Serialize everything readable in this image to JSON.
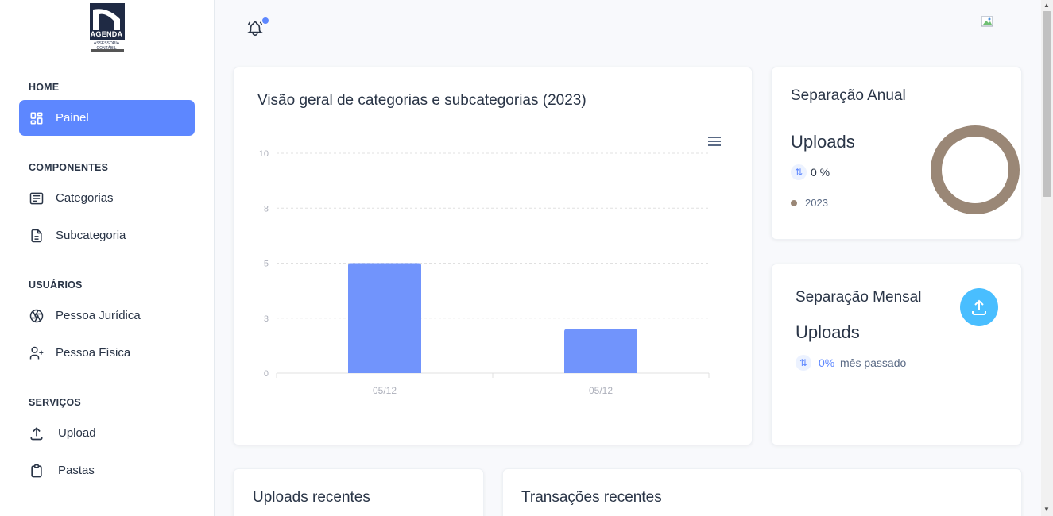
{
  "logo": {
    "brand": "AGENDA",
    "tagline": "ASSESSORIA CONTÁBIL"
  },
  "sidebar": {
    "sections": [
      {
        "caption": "HOME",
        "items": [
          {
            "label": "Painel",
            "icon": "layout-dashboard-icon",
            "active": true
          }
        ]
      },
      {
        "caption": "COMPONENTES",
        "items": [
          {
            "label": "Categorias",
            "icon": "article-icon"
          },
          {
            "label": "Subcategoria",
            "icon": "file-description-icon"
          }
        ]
      },
      {
        "caption": "USUÁRIOS",
        "items": [
          {
            "label": "Pessoa Jurídica",
            "icon": "aperture-icon"
          },
          {
            "label": "Pessoa Física",
            "icon": "user-plus-icon"
          }
        ]
      },
      {
        "caption": "SERVIÇOS",
        "items": [
          {
            "label": "Upload",
            "icon": "upload-icon"
          },
          {
            "label": "Pastas",
            "icon": "clipboard-icon"
          }
        ]
      }
    ]
  },
  "overview": {
    "title": "Visão geral de categorias e subcategorias (2023)"
  },
  "chart_data": {
    "type": "bar",
    "categories": [
      "05/12",
      "05/12"
    ],
    "values": [
      5,
      2
    ],
    "yticks": [
      "10",
      "8",
      "5",
      "3",
      "0"
    ],
    "ylim": [
      0,
      10
    ],
    "color": "#7194fc",
    "grid": true
  },
  "annual": {
    "title": "Separação Anual",
    "metric": "Uploads",
    "percent": "0 %",
    "legend": "2023",
    "donut_color": "#9a8776"
  },
  "monthly": {
    "title": "Separação Mensal",
    "metric": "Uploads",
    "percent": "0%",
    "suffix": "mês passado"
  },
  "recent_uploads": {
    "title": "Uploads recentes"
  },
  "recent_transactions": {
    "title": "Transações recentes"
  },
  "colors": {
    "primary": "#5d87ff",
    "secondary": "#49beff",
    "brown": "#9a8776"
  }
}
